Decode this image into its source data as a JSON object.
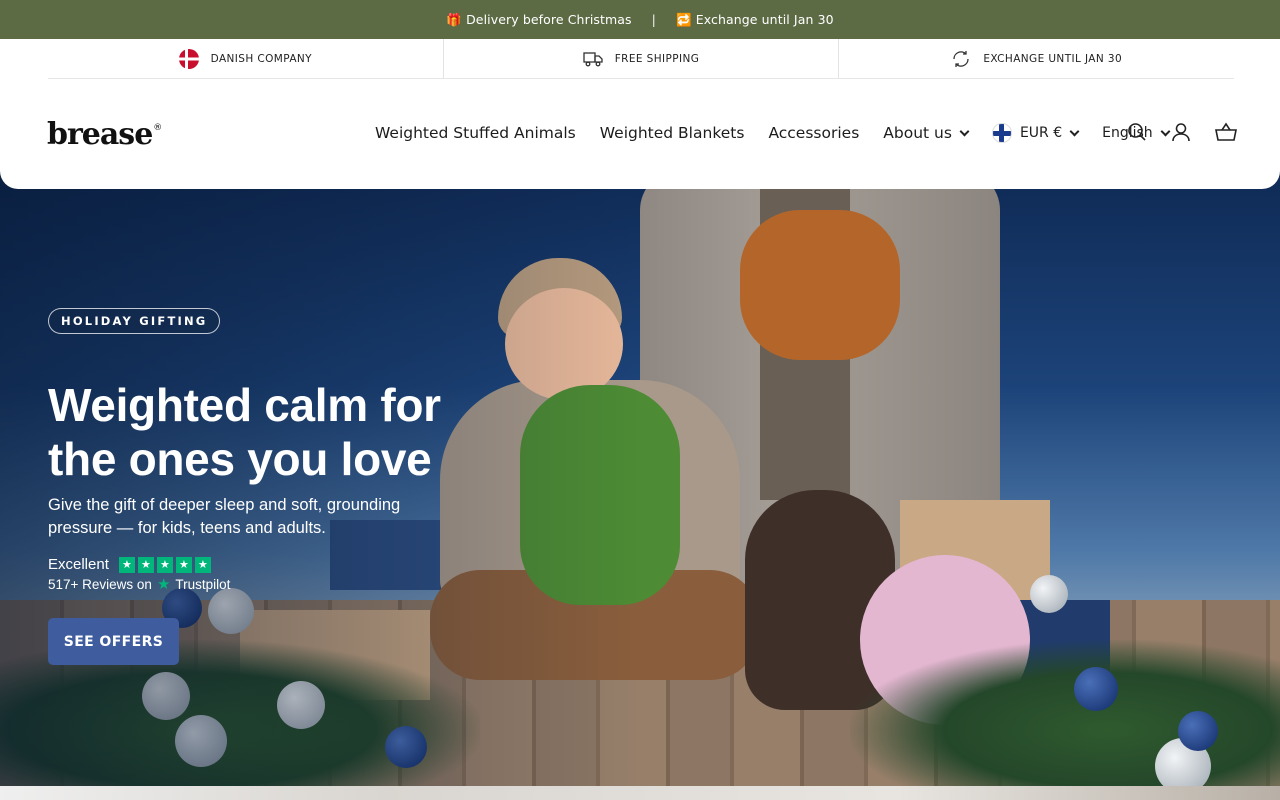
{
  "announcement": {
    "item1": "🎁 Delivery before Christmas",
    "separator": "|",
    "item2": "🔁 Exchange until Jan 30"
  },
  "usp": [
    {
      "icon": "danish-flag-icon",
      "label": "DANISH COMPANY"
    },
    {
      "icon": "truck-icon",
      "label": "FREE SHIPPING"
    },
    {
      "icon": "exchange-icon",
      "label": "EXCHANGE UNTIL JAN 30"
    }
  ],
  "header": {
    "logo": "brease",
    "logo_mark": "®",
    "nav": [
      "Weighted Stuffed Animals",
      "Weighted Blankets",
      "Accessories",
      "About us"
    ],
    "currency": "EUR €",
    "language": "English",
    "icons": [
      "search-icon",
      "account-icon",
      "cart-icon"
    ]
  },
  "hero": {
    "badge": "HOLIDAY GIFTING",
    "title": "Weighted calm for the ones you love",
    "subtitle": "Give the gift of deeper sleep and soft, grounding pressure — for kids, teens and adults.",
    "rating_label": "Excellent",
    "reviews_text": "517+ Reviews on",
    "trustpilot": "Trustpilot",
    "stars": 5,
    "cta": "SEE OFFERS"
  },
  "colors": {
    "announcement_bg": "#5d6b45",
    "cta_bg": "#3e5c9e",
    "trustpilot_green": "#00b67a"
  }
}
